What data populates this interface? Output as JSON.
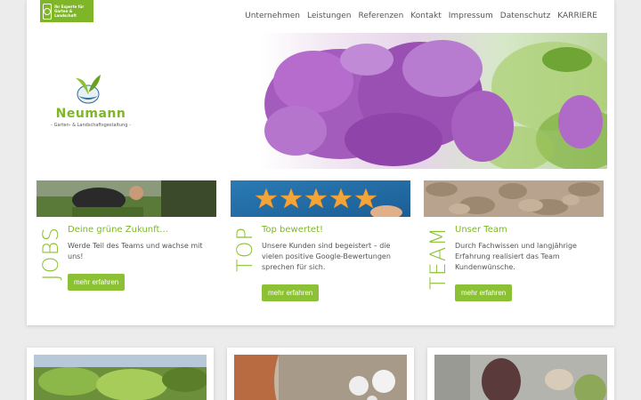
{
  "brand": {
    "badge_text": "Ihr Experte für Garten & Landschaft",
    "name": "Neumann",
    "tagline": "- Garten- & Landschaftsgestaltung -"
  },
  "nav": {
    "items": [
      "Unternehmen",
      "Leistungen",
      "Referenzen",
      "Kontakt",
      "Impressum",
      "Datenschutz",
      "KARRIERE"
    ]
  },
  "columns": [
    {
      "vertical": "JOBS",
      "title": "Deine grüne Zukunft...",
      "text": "Werde Teil des Teams und wachse mit uns!",
      "button": "mehr erfahren"
    },
    {
      "vertical": "TOP",
      "title": "Top bewertet!",
      "text": "Unsere Kunden sind begeistert – die vielen positive Google-Bewertungen sprechen für sich.",
      "button": "mehr erfahren"
    },
    {
      "vertical": "TEAM",
      "title": "Unser Team",
      "text": "Durch Fachwissen und langjährige Erfahrung realisiert das Team Kundenwünsche.",
      "button": "mehr erfahren"
    }
  ],
  "colors": {
    "accent": "#8cc035",
    "accent_dark": "#7fb628",
    "background": "#ececec"
  }
}
